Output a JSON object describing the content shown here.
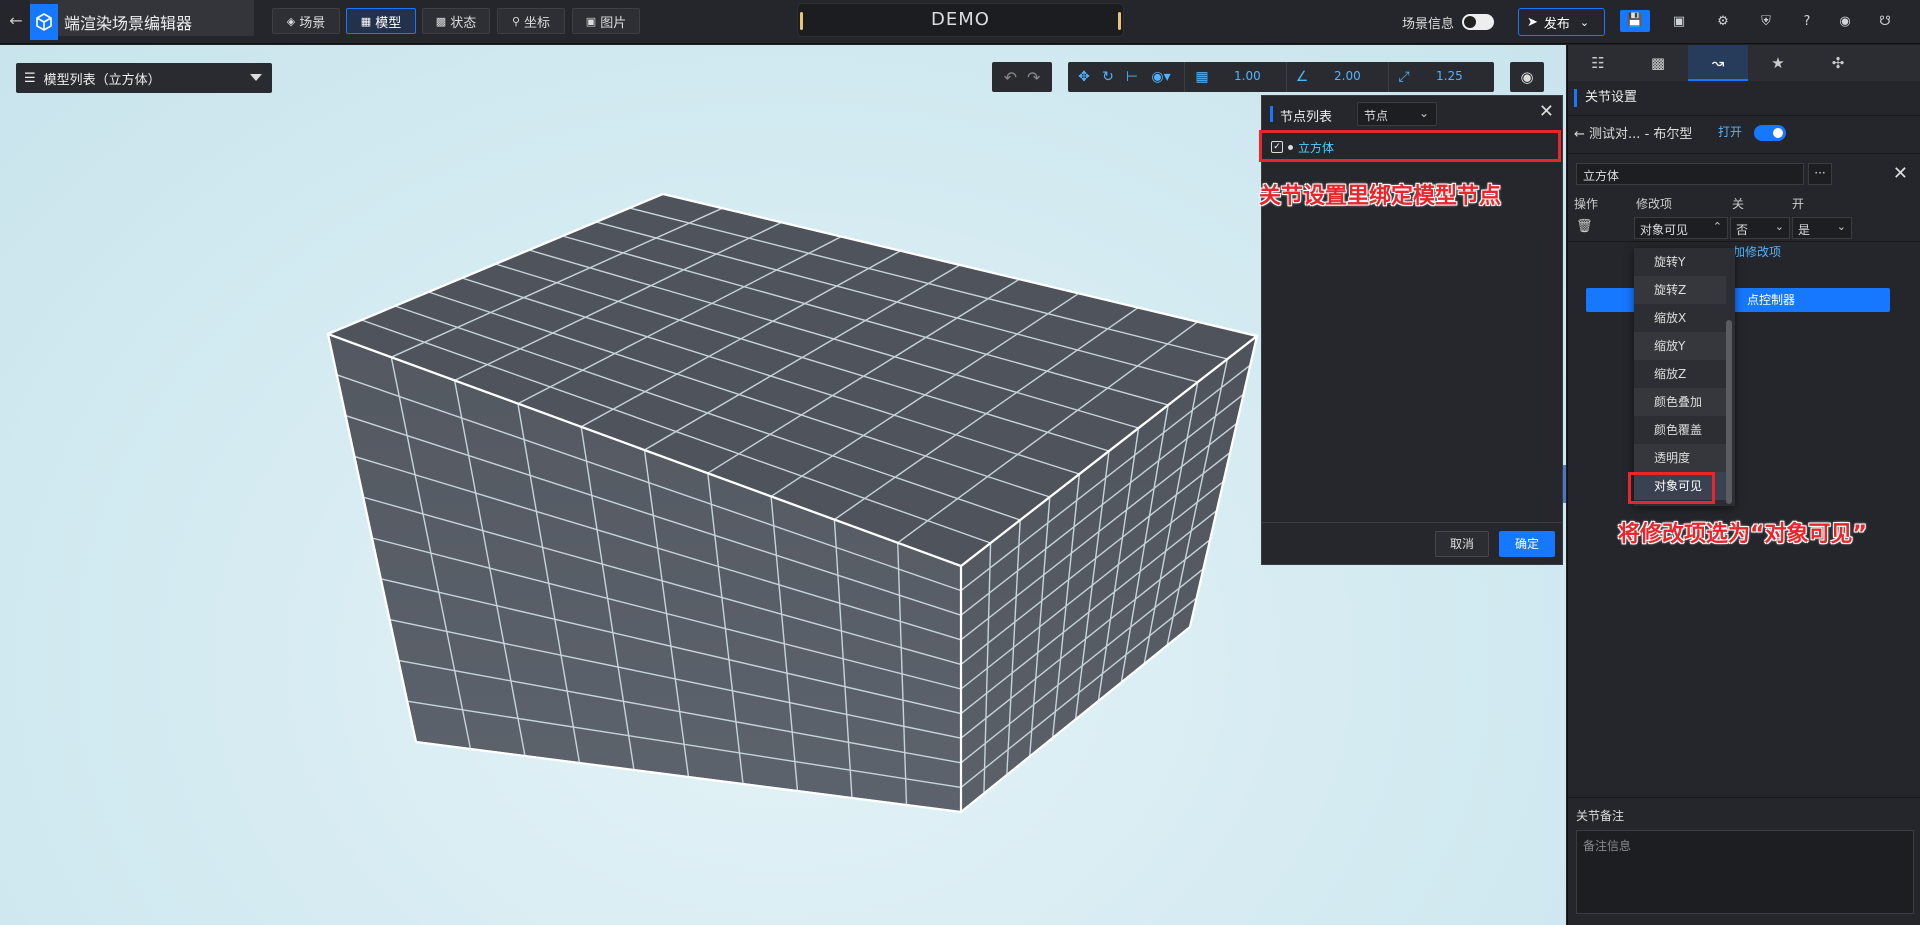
{
  "topbar": {
    "back_icon": "arrow-left-icon",
    "app_title": "端渲染场景编辑器",
    "tabs": [
      {
        "label": "场景",
        "icon": "layers-icon",
        "active": false
      },
      {
        "label": "模型",
        "icon": "cube-icon",
        "active": true
      },
      {
        "label": "状态",
        "icon": "grid-icon",
        "active": false
      },
      {
        "label": "坐标",
        "icon": "pin-icon",
        "active": false
      },
      {
        "label": "图片",
        "icon": "image-icon",
        "active": false
      }
    ],
    "center_title": "DEMO",
    "scene_info_label": "场景信息",
    "publish_label": "发布"
  },
  "viewport": {
    "model_list_label": "模型列表（立方体）",
    "toolbar_values": {
      "grid": "1.00",
      "angle": "2.00",
      "scale": "1.25"
    }
  },
  "node_dialog": {
    "title": "节点列表",
    "select_value": "节点",
    "node_label": "立方体",
    "cancel_label": "取消",
    "ok_label": "确定"
  },
  "annotations": {
    "bind_node": "关节设置里绑定模型节点",
    "select_item": "将修改项选为“对象可见”"
  },
  "right_panel": {
    "section_title": "关节设置",
    "breadcrumb": "测试对... - 布尔型",
    "open_label": "打开",
    "name_value": "立方体",
    "more_label": "···",
    "columns": [
      "操作",
      "修改项",
      "关",
      "开"
    ],
    "row": {
      "modify": "对象可见",
      "off": "否",
      "on": "是"
    },
    "add_label": "加修改项",
    "controller_label": "点控制器",
    "dropdown_items": [
      "旋转Y",
      "旋转Z",
      "缩放X",
      "缩放Y",
      "缩放Z",
      "颜色叠加",
      "颜色覆盖",
      "透明度",
      "对象可见"
    ],
    "remark_label": "关节备注",
    "remark_placeholder": "备注信息"
  },
  "colors": {
    "accent": "#1677ff",
    "annotation_red": "#e8262b",
    "highlight_cyan": "#4fd0ff"
  }
}
